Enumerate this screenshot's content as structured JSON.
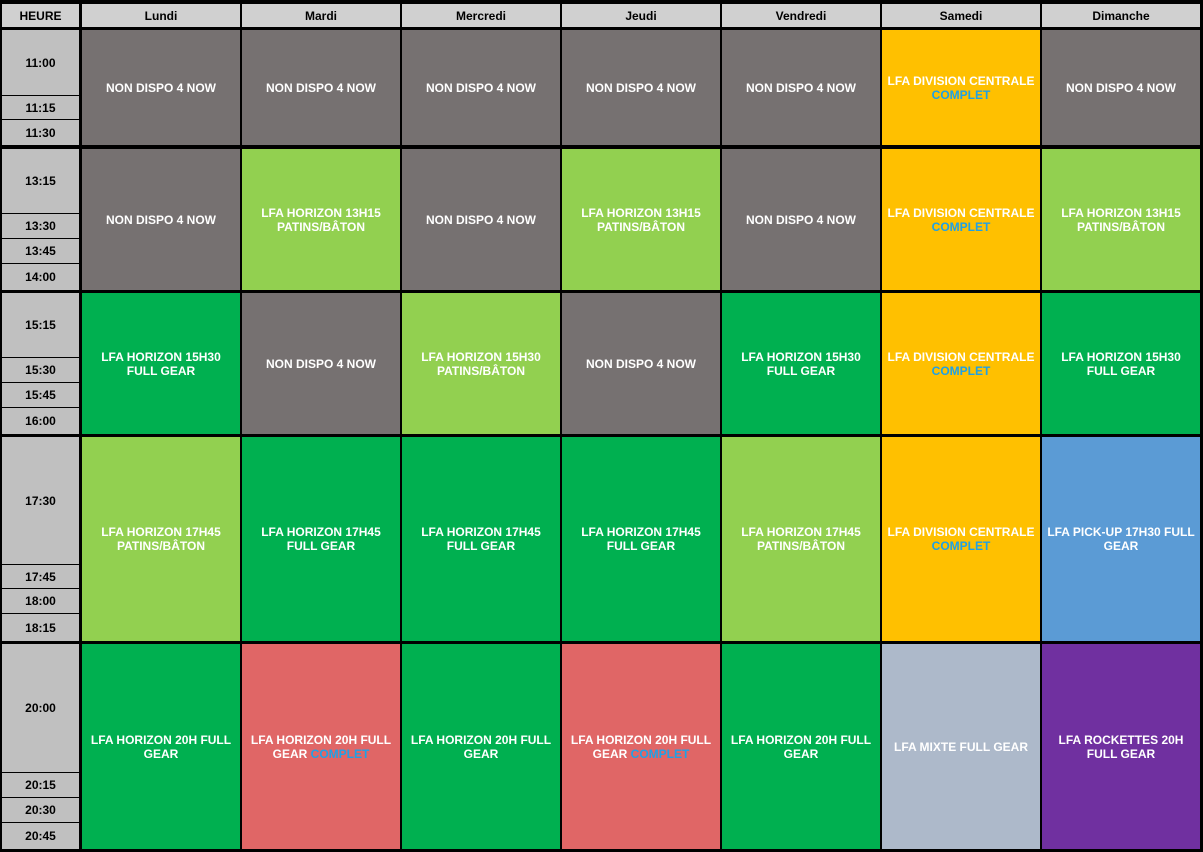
{
  "header": {
    "time_label": "HEURE",
    "days": [
      "Lundi",
      "Mardi",
      "Mercredi",
      "Jeudi",
      "Vendredi",
      "Samedi",
      "Dimanche"
    ]
  },
  "colors": {
    "unavailable": "#767171",
    "patins_baton": "#92d050",
    "full_gear": "#00b050",
    "division_centrale": "#ffc000",
    "pick_up": "#5b9bd5",
    "complet_session": "#e06666",
    "mixte": "#adb9ca",
    "rockettes": "#7030a0",
    "complet_text": "#1fa1e6"
  },
  "blocks": [
    {
      "times": [
        "11:00",
        "11:15",
        "11:30"
      ],
      "slots": [
        {
          "text": "NON DISPO 4 NOW",
          "style": "grey"
        },
        {
          "text": "NON DISPO 4 NOW",
          "style": "grey"
        },
        {
          "text": "NON DISPO 4 NOW",
          "style": "grey"
        },
        {
          "text": "NON DISPO 4 NOW",
          "style": "grey"
        },
        {
          "text": "NON DISPO 4 NOW",
          "style": "grey"
        },
        {
          "text": "LFA DIVISION CENTRALE",
          "tail": "COMPLET",
          "style": "orange",
          "tail_newline": true
        },
        {
          "text": "NON DISPO 4 NOW",
          "style": "grey"
        }
      ]
    },
    {
      "times": [
        "13:15",
        "13:30",
        "13:45",
        "14:00"
      ],
      "slots": [
        {
          "text": "NON DISPO 4 NOW",
          "style": "grey"
        },
        {
          "text": "LFA HORIZON 13H15 PATINS/BÂTON",
          "style": "lime"
        },
        {
          "text": "NON DISPO 4 NOW",
          "style": "grey"
        },
        {
          "text": "LFA HORIZON 13H15 PATINS/BÂTON",
          "style": "lime"
        },
        {
          "text": "NON DISPO 4 NOW",
          "style": "grey"
        },
        {
          "text": "LFA DIVISION CENTRALE",
          "tail": "COMPLET",
          "style": "orange",
          "tail_newline": true
        },
        {
          "text": "LFA HORIZON 13H15 PATINS/BÂTON",
          "style": "lime"
        }
      ]
    },
    {
      "times": [
        "15:15",
        "15:30",
        "15:45",
        "16:00"
      ],
      "slots": [
        {
          "text": "LFA HORIZON 15H30 FULL GEAR",
          "style": "green"
        },
        {
          "text": "NON DISPO 4 NOW",
          "style": "grey"
        },
        {
          "text": "LFA HORIZON 15H30 PATINS/BÂTON",
          "style": "lime"
        },
        {
          "text": "NON DISPO 4 NOW",
          "style": "grey"
        },
        {
          "text": "LFA HORIZON 15H30 FULL GEAR",
          "style": "green"
        },
        {
          "text": "LFA DIVISION CENTRALE",
          "tail": "COMPLET",
          "style": "orange",
          "tail_newline": true
        },
        {
          "text": "LFA HORIZON 15H30 FULL GEAR",
          "style": "green"
        }
      ]
    },
    {
      "times": [
        "17:30",
        "17:45",
        "18:00",
        "18:15"
      ],
      "slots": [
        {
          "text": "LFA HORIZON 17H45 PATINS/BÂTON",
          "style": "lime"
        },
        {
          "text": "LFA HORIZON 17H45  FULL GEAR",
          "style": "green"
        },
        {
          "text": "LFA HORIZON 17H45  FULL GEAR",
          "style": "green"
        },
        {
          "text": "LFA HORIZON 17H45  FULL GEAR",
          "style": "green"
        },
        {
          "text": "LFA HORIZON 17H45 PATINS/BÂTON",
          "style": "lime"
        },
        {
          "text": "LFA DIVISION CENTRALE",
          "tail": "COMPLET",
          "style": "orange",
          "tail_newline": true
        },
        {
          "text": "LFA PICK-UP 17H30 FULL GEAR",
          "style": "blue"
        }
      ]
    },
    {
      "times": [
        "20:00",
        "20:15",
        "20:30",
        "20:45"
      ],
      "slots": [
        {
          "text": "LFA HORIZON 20H FULL GEAR",
          "style": "green"
        },
        {
          "text": "LFA HORIZON 20H FULL GEAR",
          "tail": "COMPLET",
          "style": "red",
          "tail_newline": false
        },
        {
          "text": "LFA HORIZON 20H FULL GEAR",
          "style": "green"
        },
        {
          "text": "LFA HORIZON 20H FULL GEAR",
          "tail": "COMPLET",
          "style": "red",
          "tail_newline": false
        },
        {
          "text": "LFA HORIZON 20H FULL GEAR",
          "style": "green"
        },
        {
          "text": "LFA MIXTE FULL GEAR",
          "style": "silver"
        },
        {
          "text": "LFA ROCKETTES 20H FULL GEAR",
          "style": "purple"
        }
      ]
    }
  ]
}
